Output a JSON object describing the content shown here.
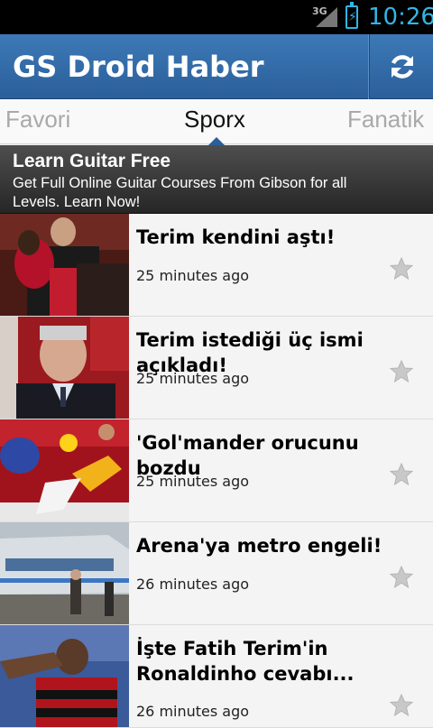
{
  "status_bar": {
    "network": "3G",
    "time": "10:26"
  },
  "action_bar": {
    "title": "GS Droid Haber",
    "refresh_icon": "refresh-icon"
  },
  "tabs": [
    {
      "label": "Favori",
      "selected": false
    },
    {
      "label": "Sporx",
      "selected": true
    },
    {
      "label": "Fanatik",
      "selected": false
    }
  ],
  "ad": {
    "title": "Learn Guitar Free",
    "description": "Get Full Online Guitar Courses From Gibson for all Levels. Learn Now!",
    "icon": "share-arrow-icon"
  },
  "news": [
    {
      "headline": "Terim kendini aştı!",
      "time": "25 minutes ago",
      "favorite": false
    },
    {
      "headline": "Terim istediği üç ismi açıkladı!",
      "time": "25 minutes ago",
      "favorite": false
    },
    {
      "headline": "'Gol'mander orucunu bozdu",
      "time": "25 minutes ago",
      "favorite": false
    },
    {
      "headline": "Arena'ya metro engeli!",
      "time": "26 minutes ago",
      "favorite": false
    },
    {
      "headline": "İşte Fatih Terim'in Ronaldinho cevabı...",
      "time": "26 minutes ago",
      "favorite": false
    }
  ],
  "colors": {
    "accent": "#33b5e5",
    "action_bar": "#2f6aa8",
    "ad_button": "#3a86d8"
  }
}
